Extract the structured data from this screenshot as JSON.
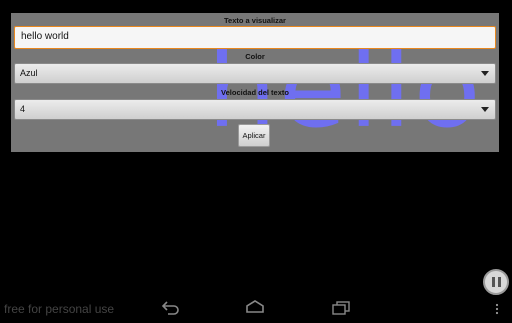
{
  "app": {
    "big_preview_text": "hello",
    "label_text": "Texto a visualizar",
    "text_value": "hello world",
    "label_color": "Color",
    "color_value": "Azul",
    "label_speed": "Velocidad del texto",
    "speed_value": "4",
    "apply_label": "Aplicar"
  },
  "system": {
    "watermark": "free for personal use"
  },
  "icons": [
    "back-icon",
    "home-icon",
    "recent-apps-icon",
    "overflow-menu-icon",
    "pause-icon",
    "dropdown-arrow-icon"
  ],
  "colors": {
    "preview_text": "#6f6ff0",
    "panel_bg": "#777777",
    "input_focus_border": "#e8871e"
  }
}
